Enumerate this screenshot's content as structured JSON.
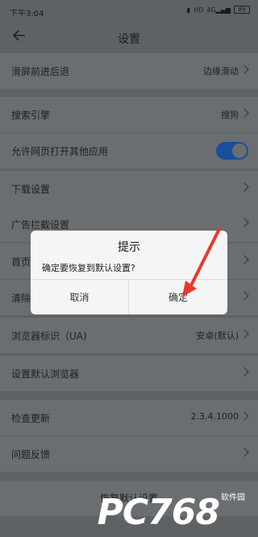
{
  "statusbar": {
    "time": "下午3:04",
    "icons": [
      "sim-icon",
      "volte-icon",
      "signal-4g-icon"
    ],
    "battery": "89"
  },
  "header": {
    "title": "设置",
    "back_icon": "arrow-left-icon"
  },
  "settings": [
    {
      "label": "滑屏前进后退",
      "value": "边缘滑动",
      "control": "chevron"
    },
    {
      "label": "搜索引擎",
      "value": "搜狗",
      "control": "chevron"
    },
    {
      "label": "允许网页打开其他应用",
      "value": "",
      "control": "toggle",
      "on": true
    },
    {
      "label": "下载设置",
      "value": "",
      "control": "chevron"
    },
    {
      "label": "广告拦截设置",
      "value": "",
      "control": "chevron"
    },
    {
      "label": "首页",
      "value": "",
      "control": "chevron"
    },
    {
      "label": "清除",
      "value": "",
      "control": "chevron"
    },
    {
      "label": "浏览器标识（UA)",
      "value": "安卓(默认)",
      "control": "chevron"
    },
    {
      "label": "设置默认浏览器",
      "value": "",
      "control": "chevron"
    },
    {
      "label": "检查更新",
      "value": "2.3.4.1000",
      "control": "chevron"
    },
    {
      "label": "问题反馈",
      "value": "",
      "control": "chevron"
    }
  ],
  "restore_label": "恢复默认设置",
  "dialog": {
    "title": "提示",
    "message": "确定要恢复到默认设置?",
    "cancel": "取消",
    "confirm": "确定"
  },
  "colors": {
    "overlay_bg": "#5f6264",
    "toggle_on": "#1a4e9c",
    "arrow": "#e8382f"
  },
  "watermark": {
    "main": "PC768",
    "sub": "软件园"
  }
}
